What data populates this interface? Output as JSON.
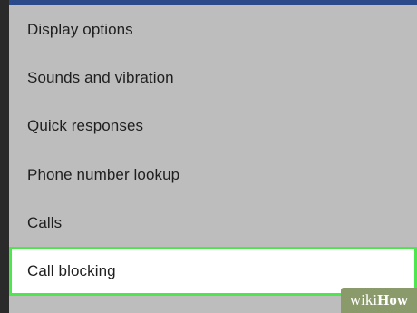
{
  "menu": {
    "items": [
      {
        "label": "Display options",
        "highlighted": false
      },
      {
        "label": "Sounds and vibration",
        "highlighted": false
      },
      {
        "label": "Quick responses",
        "highlighted": false
      },
      {
        "label": "Phone number lookup",
        "highlighted": false
      },
      {
        "label": "Calls",
        "highlighted": false
      },
      {
        "label": "Call blocking",
        "highlighted": true
      }
    ]
  },
  "watermark": {
    "part1": "wiki",
    "part2": "How"
  },
  "colors": {
    "background": "#bdbdbd",
    "top_bar": "#2b4a8a",
    "highlight_border": "#4ee64e",
    "highlight_fill": "#ffffff"
  }
}
